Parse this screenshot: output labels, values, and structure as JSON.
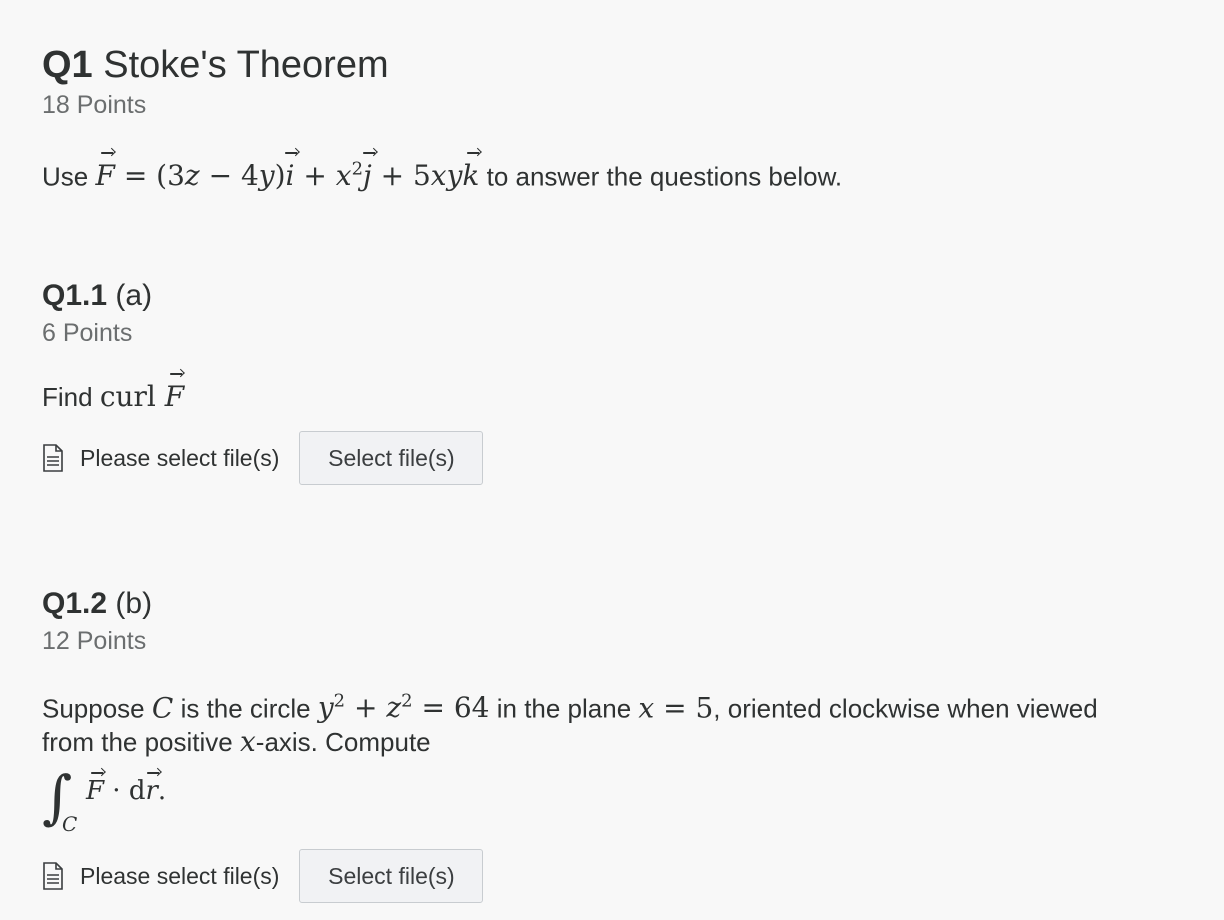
{
  "q1": {
    "number": "Q1",
    "title": "Stoke's Theorem",
    "points": "18 Points",
    "intro_prefix": "Use",
    "intro_suffix": "to answer the questions below.",
    "field": {
      "F": "F",
      "eq": " = (3",
      "z": "z",
      "minus": " − 4",
      "y": "y",
      "close": ")",
      "i": "i",
      "plus1": " + ",
      "x": "x",
      "sq": "2",
      "j": "j",
      "plus2": " + 5",
      "xy": "xy",
      "k": "k"
    }
  },
  "q1_1": {
    "number": "Q1.1",
    "title": "(a)",
    "points": "6 Points",
    "prompt_prefix": "Find",
    "curl": "curl",
    "F": "F"
  },
  "q1_2": {
    "number": "Q1.2",
    "title": "(b)",
    "points": "12 Points",
    "line1": {
      "p1": "Suppose",
      "C": "C",
      "p2": "is the circle",
      "y": "y",
      "y_exp": "2",
      "plus": " + ",
      "z": "z",
      "z_exp": "2",
      "eq": " = 64",
      "p3": "in the plane",
      "x": "x",
      "x_eq": " = 5",
      "p4": ", oriented clockwise when viewed"
    },
    "line2": {
      "p1": "from the positive",
      "x": "x",
      "p2": "-axis. Compute"
    },
    "integral": {
      "sign": "∫",
      "sub": "C",
      "F": "F",
      "dot": " · d",
      "r": "r",
      "end": "."
    }
  },
  "upload": {
    "icon": "document-icon",
    "label": "Please select file(s)",
    "button": "Select file(s)"
  }
}
